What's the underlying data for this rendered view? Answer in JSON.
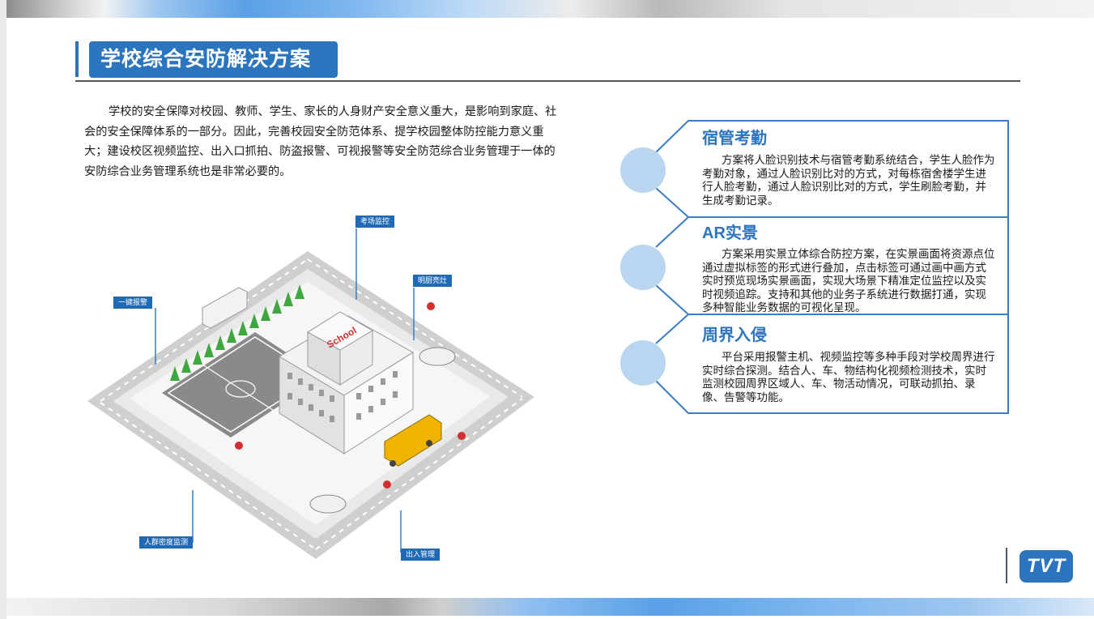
{
  "slide": {
    "title": "学校综合安防解决方案",
    "intro": "学校的安全保障对校园、教师、学生、家长的人身财产安全意义重大，是影响到家庭、社会的安全保障体系的一部分。因此，完善校园安全防范体系、提学校园整体防控能力意义重大；建设校区视频监控、出入口抓拍、防盗报警、可视报警等安全防范综合业务管理于一体的安防综合业务管理系统也是非常必要的。"
  },
  "illustration": {
    "labels": {
      "exam": "考场监控",
      "kitchen": "明厨亮灶",
      "alarm": "一键报警",
      "crowd": "人群密度监测",
      "access": "出入管理"
    },
    "school_sign": "School"
  },
  "cards": [
    {
      "title": "宿管考勤",
      "text": "方案将人脸识别技术与宿管考勤系统结合，学生人脸作为考勤对象，通过人脸识别比对的方式，对每栋宿舍楼学生进行人脸考勤，通过人脸识别比对的方式，学生刷脸考勤，并生成考勤记录。"
    },
    {
      "title": "AR实景",
      "text": "方案采用实景立体综合防控方案，在实景画面将资源点位通过虚拟标签的形式进行叠加，点击标签可通过画中画方式实时预览现场实景画面，实现大场景下精准定位监控以及实时视频追踪。支持和其他的业务子系统进行数据打通，实现多种智能业务数据的可视化呈现。"
    },
    {
      "title": "周界入侵",
      "text": "平台采用报警主机、视频监控等多种手段对学校周界进行实时综合探测。结合人、车、物结构化视频检测技术，实时监测校园周界区域人、车、物活动情况，可联动抓拍、录像、告警等功能。"
    }
  ],
  "logo": {
    "text": "TVT"
  },
  "colors": {
    "accent": "#2b74be",
    "circle": "#b9d5ef"
  }
}
